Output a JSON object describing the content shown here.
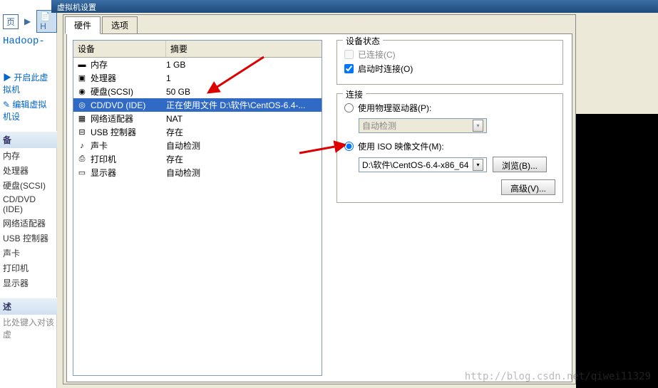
{
  "window": {
    "title": "虚拟机设置"
  },
  "background": {
    "tab_page": "页",
    "tab_home": "H",
    "project_name": "Hadoop-",
    "action_open": "开启此虚拟机",
    "action_edit": "编辑虚拟机设",
    "section_devices": "备",
    "items": {
      "memory": "内存",
      "cpu": "处理器",
      "disk": "硬盘(SCSI)",
      "cddvd": "CD/DVD (IDE)",
      "network": "网络适配器",
      "usb": "USB 控制器",
      "sound": "声卡",
      "printer": "打印机",
      "display": "显示器"
    },
    "section_desc": "述",
    "desc_placeholder": "比处键入对该虚"
  },
  "tabs": {
    "hardware": "硬件",
    "options": "选项"
  },
  "columns": {
    "device": "设备",
    "summary": "摘要"
  },
  "devices": [
    {
      "icon": "memory",
      "name": "内存",
      "summary": "1 GB"
    },
    {
      "icon": "cpu",
      "name": "处理器",
      "summary": "1"
    },
    {
      "icon": "disk",
      "name": "硬盘(SCSI)",
      "summary": "50 GB"
    },
    {
      "icon": "cd",
      "name": "CD/DVD (IDE)",
      "summary": "正在使用文件 D:\\软件\\CentOS-6.4-..."
    },
    {
      "icon": "net",
      "name": "网络适配器",
      "summary": "NAT"
    },
    {
      "icon": "usb",
      "name": "USB 控制器",
      "summary": "存在"
    },
    {
      "icon": "sound",
      "name": "声卡",
      "summary": "自动检测"
    },
    {
      "icon": "printer",
      "name": "打印机",
      "summary": "存在"
    },
    {
      "icon": "display",
      "name": "显示器",
      "summary": "自动检测"
    }
  ],
  "selected_device_index": 3,
  "status": {
    "legend": "设备状态",
    "connected": "已连接(C)",
    "connect_on_start": "启动时连接(O)"
  },
  "connection": {
    "legend": "连接",
    "physical": "使用物理驱动器(P):",
    "physical_option": "自动检测",
    "iso": "使用 ISO 映像文件(M):",
    "iso_path": "D:\\软件\\CentOS-6.4-x86_64",
    "browse": "浏览(B)...",
    "advanced": "高级(V)..."
  },
  "watermark": "http://blog.csdn.net/qiwei11329"
}
